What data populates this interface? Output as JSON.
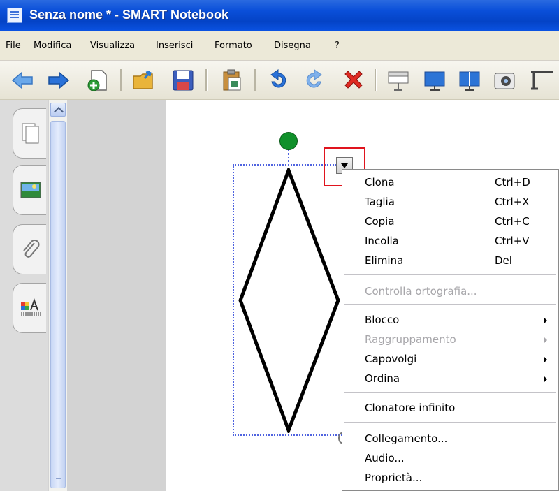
{
  "window": {
    "title": "Senza nome * - SMART Notebook"
  },
  "menubar": {
    "items": [
      "File",
      "Modifica",
      "Visualizza",
      "Inserisci",
      "Formato",
      "Disegna",
      "?"
    ]
  },
  "toolbar": {
    "buttons": [
      "back-arrow-icon",
      "forward-arrow-icon",
      "new-page-icon",
      "open-folder-icon",
      "save-disk-icon",
      "paste-icon",
      "undo-icon",
      "redo-icon",
      "delete-x-icon",
      "screen-shade-icon",
      "full-screen-icon",
      "dual-page-icon",
      "capture-icon",
      "table-icon"
    ]
  },
  "context_menu": {
    "sections": [
      [
        {
          "label": "Clona",
          "shortcut": "Ctrl+D",
          "enabled": true,
          "submenu": false
        },
        {
          "label": "Taglia",
          "shortcut": "Ctrl+X",
          "enabled": true,
          "submenu": false
        },
        {
          "label": "Copia",
          "shortcut": "Ctrl+C",
          "enabled": true,
          "submenu": false
        },
        {
          "label": "Incolla",
          "shortcut": "Ctrl+V",
          "enabled": true,
          "submenu": false
        },
        {
          "label": "Elimina",
          "shortcut": "Del",
          "enabled": true,
          "submenu": false
        }
      ],
      [
        {
          "label": "Controlla ortografia...",
          "shortcut": "",
          "enabled": false,
          "submenu": false
        }
      ],
      [
        {
          "label": "Blocco",
          "shortcut": "",
          "enabled": true,
          "submenu": true
        },
        {
          "label": "Raggruppamento",
          "shortcut": "",
          "enabled": false,
          "submenu": true
        },
        {
          "label": "Capovolgi",
          "shortcut": "",
          "enabled": true,
          "submenu": true
        },
        {
          "label": "Ordina",
          "shortcut": "",
          "enabled": true,
          "submenu": true
        }
      ],
      [
        {
          "label": "Clonatore infinito",
          "shortcut": "",
          "enabled": true,
          "submenu": false
        }
      ],
      [
        {
          "label": "Collegamento...",
          "shortcut": "",
          "enabled": true,
          "submenu": false
        },
        {
          "label": "Audio...",
          "shortcut": "",
          "enabled": true,
          "submenu": false
        },
        {
          "label": "Proprietà...",
          "shortcut": "",
          "enabled": true,
          "submenu": false
        }
      ]
    ]
  },
  "colors": {
    "titlebar": "#0a4fd9",
    "rotate_handle": "#10902a",
    "selection": "#4f63e0",
    "highlight": "#e0141e"
  }
}
